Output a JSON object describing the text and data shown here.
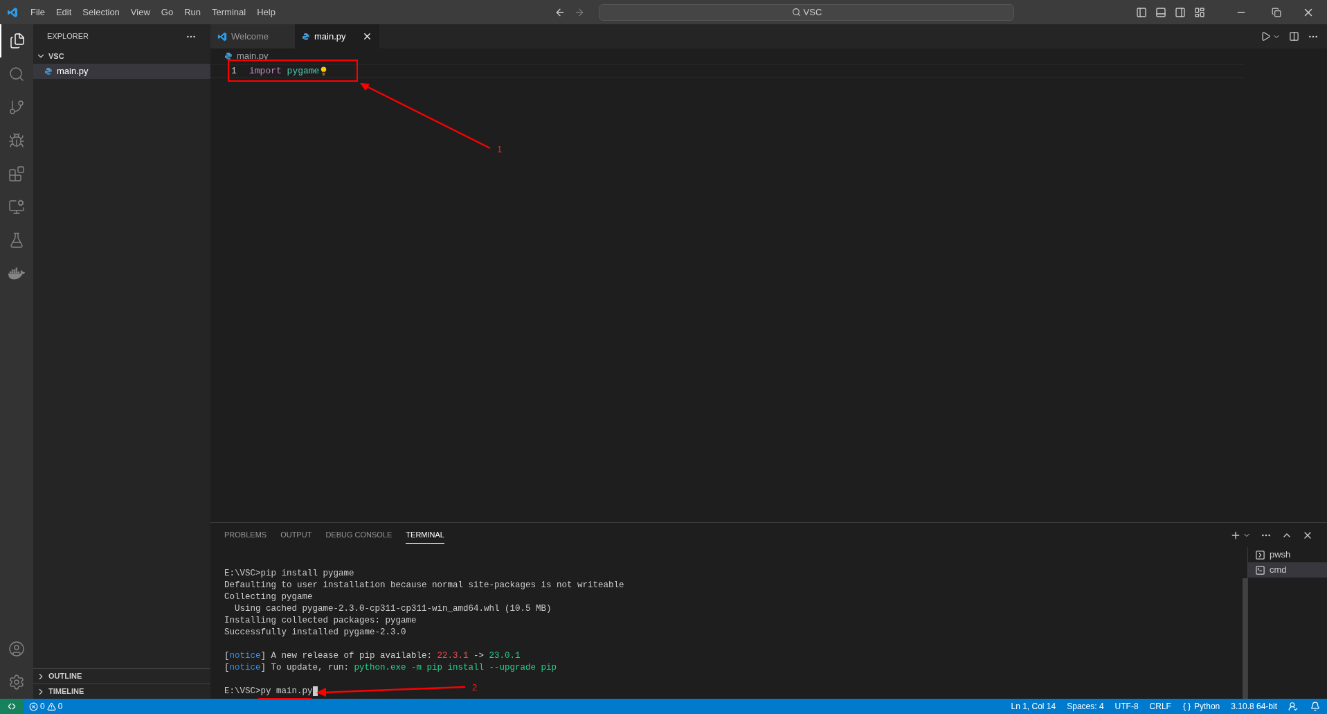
{
  "title_bar": {
    "menu": [
      "File",
      "Edit",
      "Selection",
      "View",
      "Go",
      "Run",
      "Terminal",
      "Help"
    ],
    "search": "VSC"
  },
  "sidebar": {
    "title": "EXPLORER",
    "folder": {
      "label": "VSC",
      "expanded": true,
      "children": [
        {
          "label": "main.py",
          "selected": true
        }
      ]
    },
    "sections": [
      {
        "label": "OUTLINE",
        "expanded": false
      },
      {
        "label": "TIMELINE",
        "expanded": false
      }
    ]
  },
  "editor": {
    "tabs": [
      {
        "label": "Welcome",
        "kind": "welcome",
        "selected": false
      },
      {
        "label": "main.py",
        "kind": "python",
        "selected": true
      }
    ],
    "breadcrumb": "main.py",
    "lines": [
      {
        "number": "1",
        "tokens": [
          {
            "text": "import",
            "kind": "keyword"
          },
          {
            "text": "pygame",
            "kind": "module"
          }
        ]
      }
    ]
  },
  "panel": {
    "tabs": [
      {
        "label": "PROBLEMS",
        "selected": false
      },
      {
        "label": "OUTPUT",
        "selected": false
      },
      {
        "label": "DEBUG CONSOLE",
        "selected": false
      },
      {
        "label": "TERMINAL",
        "selected": true
      }
    ],
    "terminal_blocks": [
      [
        [
          {
            "text": "E:\\VSC>pip install pygame",
            "kind": "plain"
          }
        ],
        [
          {
            "text": "Defaulting to user installation because normal site-packages is not writeable",
            "kind": "plain"
          }
        ],
        [
          {
            "text": "Collecting pygame",
            "kind": "plain"
          }
        ],
        [
          {
            "text": "  Using cached pygame-2.3.0-cp311-cp311-win_amd64.whl (10.5 MB)",
            "kind": "plain"
          }
        ],
        [
          {
            "text": "Installing collected packages: pygame",
            "kind": "plain"
          }
        ],
        [
          {
            "text": "Successfully installed pygame-2.3.0",
            "kind": "plain"
          }
        ]
      ],
      [
        [
          {
            "text": "[",
            "kind": "plain"
          },
          {
            "text": "notice",
            "kind": "notice"
          },
          {
            "text": "] A new release of pip available: ",
            "kind": "plain"
          },
          {
            "text": "22.3.1",
            "kind": "red"
          },
          {
            "text": " -> ",
            "kind": "plain"
          },
          {
            "text": "23.0.1",
            "kind": "green"
          }
        ],
        [
          {
            "text": "[",
            "kind": "plain"
          },
          {
            "text": "notice",
            "kind": "notice"
          },
          {
            "text": "] To update, run: ",
            "kind": "plain"
          },
          {
            "text": "python.exe -m pip install --upgrade pip",
            "kind": "green"
          }
        ]
      ],
      [
        [
          {
            "text": "E:\\VSC>py main.py",
            "kind": "plain"
          }
        ]
      ]
    ],
    "sessions": [
      {
        "label": "pwsh",
        "kind": "pwsh",
        "selected": false
      },
      {
        "label": "cmd",
        "kind": "cmd",
        "selected": true
      }
    ]
  },
  "status_bar": {
    "problems": [
      {
        "kind": "error",
        "count": "0"
      },
      {
        "kind": "warning",
        "count": "0"
      }
    ],
    "items": [
      {
        "label": "Ln 1, Col 14",
        "kind": "text"
      },
      {
        "label": "Spaces: 4",
        "kind": "text"
      },
      {
        "label": "UTF-8",
        "kind": "text"
      },
      {
        "label": "CRLF",
        "kind": "text"
      },
      {
        "label": "Python",
        "kind": "language"
      },
      {
        "label": "3.10.8 64-bit",
        "kind": "text"
      }
    ]
  },
  "annotations": [
    {
      "label": "1"
    },
    {
      "label": "2"
    }
  ]
}
